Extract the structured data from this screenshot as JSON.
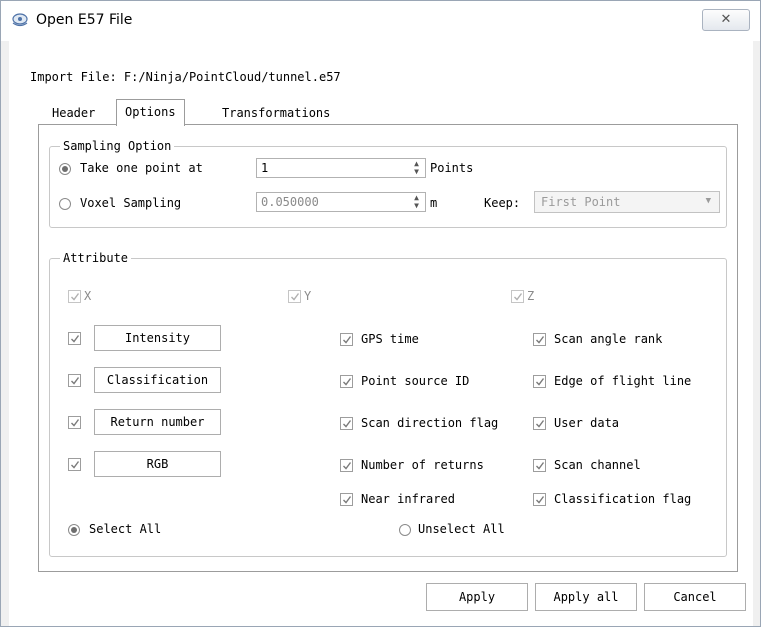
{
  "window": {
    "title": "Open E57 File",
    "close_glyph": "✕"
  },
  "import_file": "Import File: F:/Ninja/PointCloud/tunnel.e57",
  "tabs": [
    {
      "label": "Header"
    },
    {
      "label": "Options"
    },
    {
      "label": "Transformations"
    }
  ],
  "active_tab": "Options",
  "sampling": {
    "title": "Sampling Option",
    "take_one": {
      "label": "Take one point at",
      "value": "1",
      "unit": "Points",
      "selected": true
    },
    "voxel": {
      "label": "Voxel Sampling",
      "value": "0.050000",
      "unit": "m",
      "selected": false
    },
    "keep": {
      "label": "Keep:",
      "value": "First Point"
    }
  },
  "attribute": {
    "title": "Attribute",
    "xyz": [
      {
        "label": "X",
        "checked": true
      },
      {
        "label": "Y",
        "checked": true
      },
      {
        "label": "Z",
        "checked": true
      }
    ],
    "buttons": [
      {
        "label": "Intensity"
      },
      {
        "label": "Classification"
      },
      {
        "label": "Return number"
      },
      {
        "label": "RGB"
      }
    ],
    "middle": [
      {
        "label": "GPS time",
        "checked": true
      },
      {
        "label": "Point source ID",
        "checked": true
      },
      {
        "label": "Scan direction flag",
        "checked": true
      },
      {
        "label": "Number of returns",
        "checked": true
      },
      {
        "label": "Near infrared",
        "checked": true
      }
    ],
    "right": [
      {
        "label": "Scan angle rank",
        "checked": true
      },
      {
        "label": "Edge of flight line",
        "checked": true
      },
      {
        "label": "User data",
        "checked": true
      },
      {
        "label": "Scan channel",
        "checked": true
      },
      {
        "label": "Classification flag",
        "checked": true
      }
    ],
    "select_all": {
      "label": "Select All",
      "selected": true
    },
    "unselect_all": {
      "label": "Unselect All",
      "selected": false
    }
  },
  "footer": {
    "apply": "Apply",
    "apply_all": "Apply all",
    "cancel": "Cancel"
  },
  "colors": {
    "border": "#9c9c9c",
    "check": "#7a7a7a",
    "disabled_text": "#9a9a9a"
  }
}
